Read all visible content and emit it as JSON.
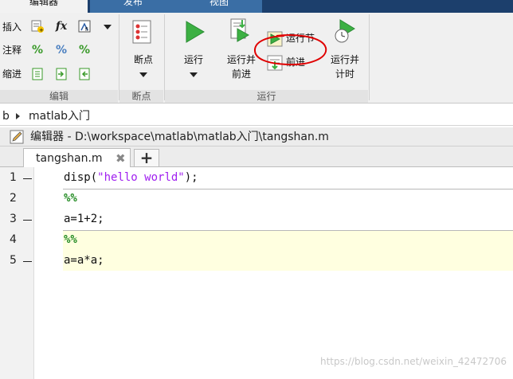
{
  "tabs": {
    "editor": "编辑器",
    "publish": "发布",
    "view": "视图"
  },
  "ribbon": {
    "edit_group": {
      "insert": "插入",
      "comment": "注释",
      "indent": "缩进",
      "label": "编辑"
    },
    "breakpoint_group": {
      "button": "断点",
      "label": "断点"
    },
    "run_group": {
      "run": "运行",
      "run_advance_line1": "运行并",
      "run_advance_line2": "前进",
      "run_section": "运行节",
      "advance": "前进",
      "run_time_line1": "运行并",
      "run_time_line2": "计时",
      "label": "运行"
    }
  },
  "breadcrumb": {
    "part1": "b",
    "part2": "matlab入门"
  },
  "editor": {
    "title": "编辑器 - D:\\workspace\\matlab\\matlab入门\\tangshan.m",
    "file_tab": "tangshan.m",
    "close_glyph": "✖",
    "add_glyph": "+"
  },
  "code": {
    "line_numbers": [
      "1",
      "2",
      "3",
      "4",
      "5"
    ],
    "line1_prefix": "disp(",
    "line1_string": "\"hello world\"",
    "line1_suffix": ");",
    "line2": "%%",
    "line3": "a=1+2;",
    "line4": "%%",
    "line5": "a=a*a;"
  },
  "watermark": "https://blog.csdn.net/weixin_42472706",
  "colors": {
    "tab_strip": "#1c3f6c",
    "ribbon_bg": "#f0f0f0",
    "cell_highlight": "#ffffe0",
    "string": "#a020f0",
    "comment": "#228b22",
    "run_green": "#3cb043",
    "annotation_red": "#e00000"
  }
}
